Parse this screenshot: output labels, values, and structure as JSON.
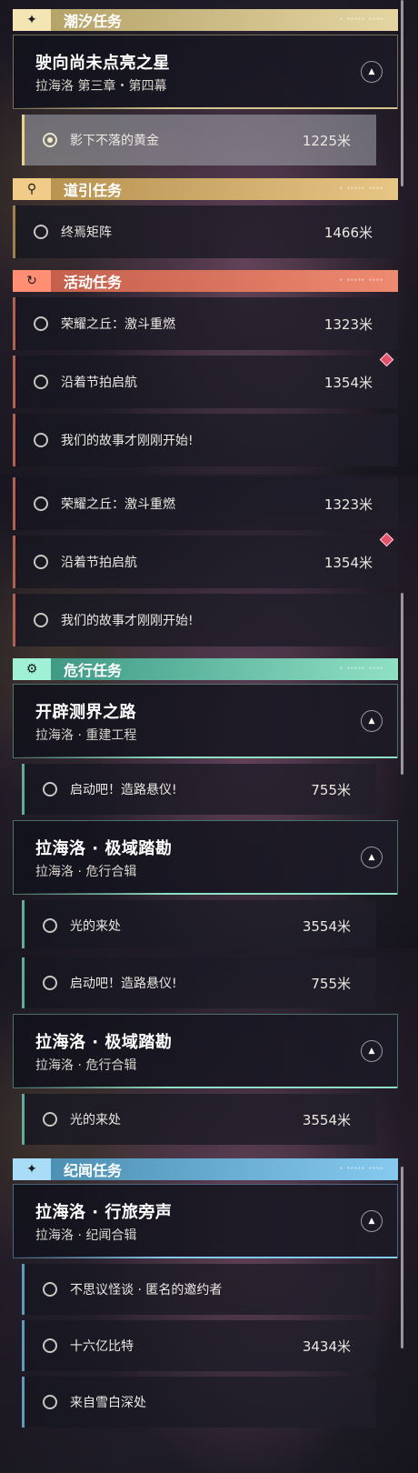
{
  "colors": {
    "tide": "#d6c48d",
    "guide": "#e8c47e",
    "activity": "#f0806a",
    "danger": "#8fe0c4",
    "record": "#86c9ef"
  },
  "categories": {
    "tide": "潮汐任务",
    "guide": "道引任务",
    "activity": "活动任务",
    "danger": "危行任务",
    "record": "纪闻任务"
  },
  "icons": {
    "tide": "sparkle-icon",
    "guide": "map-pin-icon",
    "activity": "refresh-icon",
    "danger": "gear-icon",
    "record": "sparkle-icon",
    "expand": "triangle-up-icon"
  },
  "cards": {
    "tide_main": {
      "title": "驶向尚未点亮之星",
      "sub": "拉海洛 第三章・第四幕"
    },
    "road": {
      "title": "开辟测界之路",
      "sub": "拉海洛 · 重建工程"
    },
    "polar": {
      "title": "拉海洛 · 极域踏勘",
      "sub": "拉海洛 · 危行合辑"
    },
    "travel": {
      "title": "拉海洛 · 行旅旁声",
      "sub": "拉海洛 · 纪闻合辑"
    }
  },
  "quests": {
    "shadow": {
      "name": "影下不落的黄金",
      "dist": "1225米"
    },
    "matrix": {
      "name": "终焉矩阵",
      "dist": "1466米"
    },
    "glory": {
      "name": "荣耀之丘：激斗重燃",
      "dist": "1323米"
    },
    "rhythm": {
      "name": "沿着节拍启航",
      "dist": "1354米"
    },
    "story": {
      "name": "我们的故事才刚刚开始!",
      "dist": ""
    },
    "start": {
      "name": "启动吧！造路悬仪!",
      "dist": "755米"
    },
    "light": {
      "name": "光的来处",
      "dist": "3554米"
    },
    "mystery": {
      "name": "不思议怪谈 · 匿名的邀约者",
      "dist": ""
    },
    "bits": {
      "name": "十六亿比特",
      "dist": "3434米"
    },
    "snow": {
      "name": "来自雪白深处",
      "dist": ""
    }
  }
}
